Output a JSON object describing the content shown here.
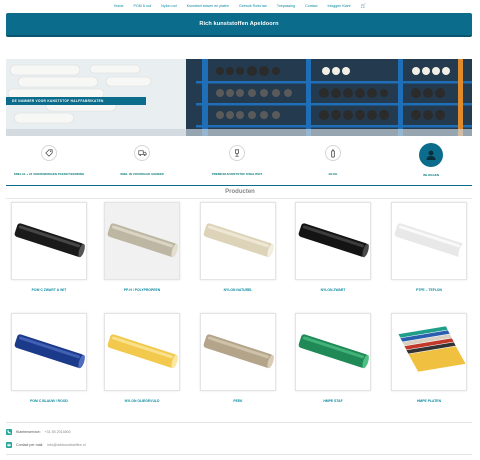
{
  "nav": {
    "items": [
      "Home",
      "POM & rod",
      "Nylon rod",
      "Kunststof staven en platen",
      "Gebruik Rods'ran",
      "Toepassing",
      "Contact",
      "Inloggen Klant"
    ],
    "cart_icon": "cart-icon"
  },
  "header": {
    "title": "Rich kunststoffen Apeldoorn"
  },
  "hero": {
    "banner_text": "DE NUMMER VOOR KUNSTSTOF HALFFABRIKATEN"
  },
  "features": [
    {
      "label": "SNELLE + 24 VERZENDINGEN PAKKET/ZENDING",
      "icon": "tag-icon",
      "active": false
    },
    {
      "label": "SNEL IN VOORRAAD GEREED",
      "icon": "truck-icon",
      "active": false
    },
    {
      "label": "PREMIUM-KUNSTSTOF KWALITEIT",
      "icon": "trophy-icon",
      "active": false
    },
    {
      "label": "BLOG",
      "icon": "bottle-icon",
      "active": false
    },
    {
      "label": "INLOGGEN",
      "icon": "user-icon",
      "active": true
    }
  ],
  "products_section": {
    "title": "Producten"
  },
  "products": [
    {
      "name": "POM C ZWART & WIT",
      "kind": "rod",
      "color": "#1a1a1a",
      "highlight": "#555555"
    },
    {
      "name": "PP-H / POLYPROPEEN",
      "kind": "rod",
      "color": "#bdb6a2",
      "highlight": "#e3dece"
    },
    {
      "name": "NYLON NATUREL",
      "kind": "rod",
      "color": "#ddd3b8",
      "highlight": "#f3eedf"
    },
    {
      "name": "NYLON ZWART",
      "kind": "rod",
      "color": "#141414",
      "highlight": "#4a4a4a"
    },
    {
      "name": "PTFE – TEFLON",
      "kind": "rod",
      "color": "#e8e8e8",
      "highlight": "#ffffff"
    },
    {
      "name": "POM C BLAUW / ROOD",
      "kind": "rod",
      "color": "#1b3a8a",
      "highlight": "#4f6cc0"
    },
    {
      "name": "NYLON OLIEGEVULD",
      "kind": "rod",
      "color": "#f2c94c",
      "highlight": "#fbe7a2"
    },
    {
      "name": "PEEK",
      "kind": "rod",
      "color": "#b3a48a",
      "highlight": "#d8ccb6"
    },
    {
      "name": "HMPE STAF",
      "kind": "rod",
      "color": "#1f8a55",
      "highlight": "#4fbf86"
    },
    {
      "name": "HMPE PLATEN",
      "kind": "plates",
      "color": "#2bb3a0",
      "highlight": "#7fdccf"
    }
  ],
  "contact": {
    "phone_label": "Klantenservice:",
    "phone_value": "+31 55 2014800",
    "mail_label": "Contact per mail:",
    "mail_value": "info@richkunststoffen.nl"
  },
  "colors": {
    "accent": "#0b6c8b",
    "link": "#0a8aa0",
    "mail": "#26a69a",
    "phone": "#26a69a"
  }
}
